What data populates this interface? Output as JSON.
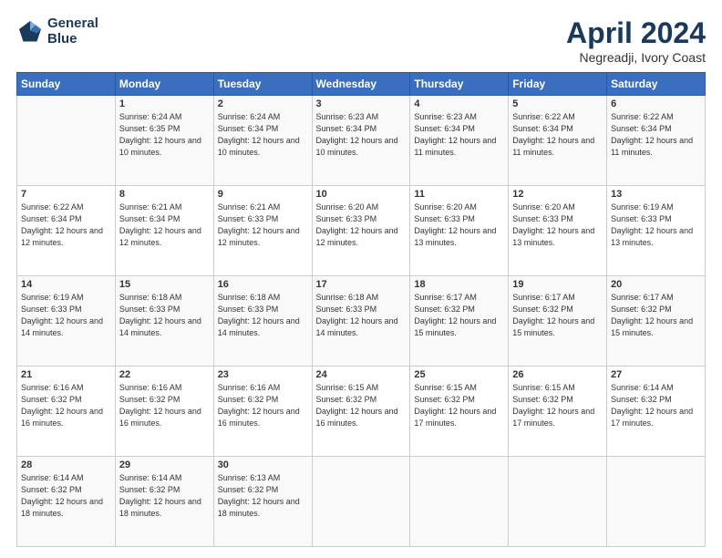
{
  "header": {
    "logo_line1": "General",
    "logo_line2": "Blue",
    "title": "April 2024",
    "location": "Negreadji, Ivory Coast"
  },
  "days_of_week": [
    "Sunday",
    "Monday",
    "Tuesday",
    "Wednesday",
    "Thursday",
    "Friday",
    "Saturday"
  ],
  "weeks": [
    [
      {
        "day": "",
        "sunrise": "",
        "sunset": "",
        "daylight": ""
      },
      {
        "day": "1",
        "sunrise": "Sunrise: 6:24 AM",
        "sunset": "Sunset: 6:35 PM",
        "daylight": "Daylight: 12 hours and 10 minutes."
      },
      {
        "day": "2",
        "sunrise": "Sunrise: 6:24 AM",
        "sunset": "Sunset: 6:34 PM",
        "daylight": "Daylight: 12 hours and 10 minutes."
      },
      {
        "day": "3",
        "sunrise": "Sunrise: 6:23 AM",
        "sunset": "Sunset: 6:34 PM",
        "daylight": "Daylight: 12 hours and 10 minutes."
      },
      {
        "day": "4",
        "sunrise": "Sunrise: 6:23 AM",
        "sunset": "Sunset: 6:34 PM",
        "daylight": "Daylight: 12 hours and 11 minutes."
      },
      {
        "day": "5",
        "sunrise": "Sunrise: 6:22 AM",
        "sunset": "Sunset: 6:34 PM",
        "daylight": "Daylight: 12 hours and 11 minutes."
      },
      {
        "day": "6",
        "sunrise": "Sunrise: 6:22 AM",
        "sunset": "Sunset: 6:34 PM",
        "daylight": "Daylight: 12 hours and 11 minutes."
      }
    ],
    [
      {
        "day": "7",
        "sunrise": "Sunrise: 6:22 AM",
        "sunset": "Sunset: 6:34 PM",
        "daylight": "Daylight: 12 hours and 12 minutes."
      },
      {
        "day": "8",
        "sunrise": "Sunrise: 6:21 AM",
        "sunset": "Sunset: 6:34 PM",
        "daylight": "Daylight: 12 hours and 12 minutes."
      },
      {
        "day": "9",
        "sunrise": "Sunrise: 6:21 AM",
        "sunset": "Sunset: 6:33 PM",
        "daylight": "Daylight: 12 hours and 12 minutes."
      },
      {
        "day": "10",
        "sunrise": "Sunrise: 6:20 AM",
        "sunset": "Sunset: 6:33 PM",
        "daylight": "Daylight: 12 hours and 12 minutes."
      },
      {
        "day": "11",
        "sunrise": "Sunrise: 6:20 AM",
        "sunset": "Sunset: 6:33 PM",
        "daylight": "Daylight: 12 hours and 13 minutes."
      },
      {
        "day": "12",
        "sunrise": "Sunrise: 6:20 AM",
        "sunset": "Sunset: 6:33 PM",
        "daylight": "Daylight: 12 hours and 13 minutes."
      },
      {
        "day": "13",
        "sunrise": "Sunrise: 6:19 AM",
        "sunset": "Sunset: 6:33 PM",
        "daylight": "Daylight: 12 hours and 13 minutes."
      }
    ],
    [
      {
        "day": "14",
        "sunrise": "Sunrise: 6:19 AM",
        "sunset": "Sunset: 6:33 PM",
        "daylight": "Daylight: 12 hours and 14 minutes."
      },
      {
        "day": "15",
        "sunrise": "Sunrise: 6:18 AM",
        "sunset": "Sunset: 6:33 PM",
        "daylight": "Daylight: 12 hours and 14 minutes."
      },
      {
        "day": "16",
        "sunrise": "Sunrise: 6:18 AM",
        "sunset": "Sunset: 6:33 PM",
        "daylight": "Daylight: 12 hours and 14 minutes."
      },
      {
        "day": "17",
        "sunrise": "Sunrise: 6:18 AM",
        "sunset": "Sunset: 6:33 PM",
        "daylight": "Daylight: 12 hours and 14 minutes."
      },
      {
        "day": "18",
        "sunrise": "Sunrise: 6:17 AM",
        "sunset": "Sunset: 6:32 PM",
        "daylight": "Daylight: 12 hours and 15 minutes."
      },
      {
        "day": "19",
        "sunrise": "Sunrise: 6:17 AM",
        "sunset": "Sunset: 6:32 PM",
        "daylight": "Daylight: 12 hours and 15 minutes."
      },
      {
        "day": "20",
        "sunrise": "Sunrise: 6:17 AM",
        "sunset": "Sunset: 6:32 PM",
        "daylight": "Daylight: 12 hours and 15 minutes."
      }
    ],
    [
      {
        "day": "21",
        "sunrise": "Sunrise: 6:16 AM",
        "sunset": "Sunset: 6:32 PM",
        "daylight": "Daylight: 12 hours and 16 minutes."
      },
      {
        "day": "22",
        "sunrise": "Sunrise: 6:16 AM",
        "sunset": "Sunset: 6:32 PM",
        "daylight": "Daylight: 12 hours and 16 minutes."
      },
      {
        "day": "23",
        "sunrise": "Sunrise: 6:16 AM",
        "sunset": "Sunset: 6:32 PM",
        "daylight": "Daylight: 12 hours and 16 minutes."
      },
      {
        "day": "24",
        "sunrise": "Sunrise: 6:15 AM",
        "sunset": "Sunset: 6:32 PM",
        "daylight": "Daylight: 12 hours and 16 minutes."
      },
      {
        "day": "25",
        "sunrise": "Sunrise: 6:15 AM",
        "sunset": "Sunset: 6:32 PM",
        "daylight": "Daylight: 12 hours and 17 minutes."
      },
      {
        "day": "26",
        "sunrise": "Sunrise: 6:15 AM",
        "sunset": "Sunset: 6:32 PM",
        "daylight": "Daylight: 12 hours and 17 minutes."
      },
      {
        "day": "27",
        "sunrise": "Sunrise: 6:14 AM",
        "sunset": "Sunset: 6:32 PM",
        "daylight": "Daylight: 12 hours and 17 minutes."
      }
    ],
    [
      {
        "day": "28",
        "sunrise": "Sunrise: 6:14 AM",
        "sunset": "Sunset: 6:32 PM",
        "daylight": "Daylight: 12 hours and 18 minutes."
      },
      {
        "day": "29",
        "sunrise": "Sunrise: 6:14 AM",
        "sunset": "Sunset: 6:32 PM",
        "daylight": "Daylight: 12 hours and 18 minutes."
      },
      {
        "day": "30",
        "sunrise": "Sunrise: 6:13 AM",
        "sunset": "Sunset: 6:32 PM",
        "daylight": "Daylight: 12 hours and 18 minutes."
      },
      {
        "day": "",
        "sunrise": "",
        "sunset": "",
        "daylight": ""
      },
      {
        "day": "",
        "sunrise": "",
        "sunset": "",
        "daylight": ""
      },
      {
        "day": "",
        "sunrise": "",
        "sunset": "",
        "daylight": ""
      },
      {
        "day": "",
        "sunrise": "",
        "sunset": "",
        "daylight": ""
      }
    ]
  ]
}
